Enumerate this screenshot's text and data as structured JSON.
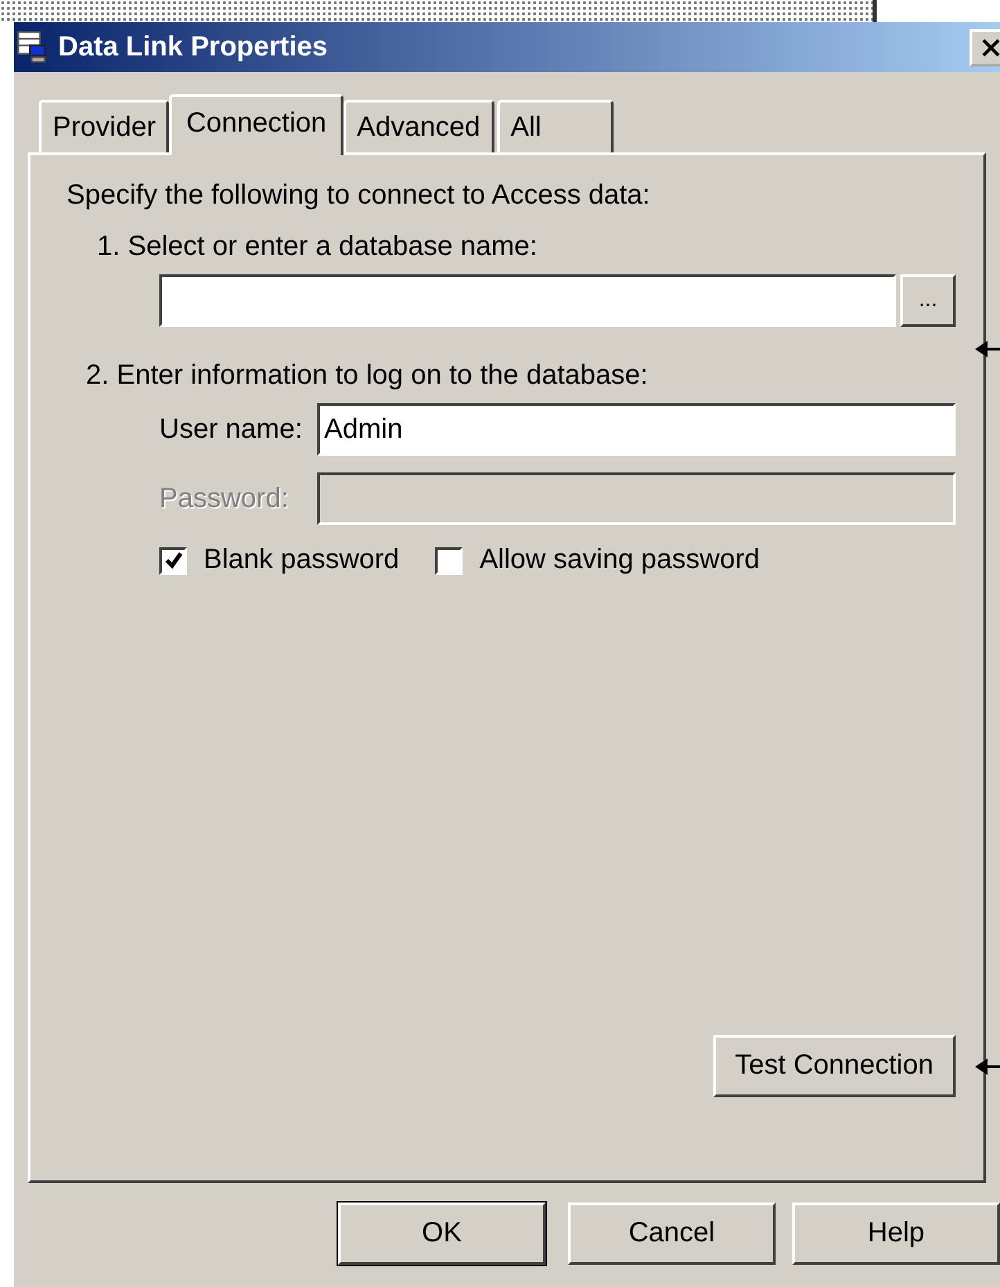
{
  "window": {
    "title": "Data Link Properties"
  },
  "tabs": [
    {
      "label": "Provider",
      "selected": false
    },
    {
      "label": "Connection",
      "selected": true
    },
    {
      "label": "Advanced",
      "selected": false
    },
    {
      "label": "All",
      "selected": false
    }
  ],
  "intro": "Specify the following to connect to Access data:",
  "step1": {
    "label": "1. Select or enter a database name:",
    "browse_button": "..."
  },
  "step2": {
    "label": "2. Enter information to log on to the database:",
    "fields": [
      {
        "label": "User name:",
        "value": "Admin",
        "disabled": false
      },
      {
        "label": "Password:",
        "disabled": true
      }
    ],
    "checkboxes": [
      {
        "label": "Blank password",
        "checked": true
      },
      {
        "label": "Allow saving password",
        "checked": false
      }
    ]
  },
  "test_button": "Test Connection",
  "buttons": [
    {
      "label": "OK",
      "default": true
    },
    {
      "label": "Cancel",
      "default": false
    },
    {
      "label": "Help",
      "default": false
    }
  ]
}
